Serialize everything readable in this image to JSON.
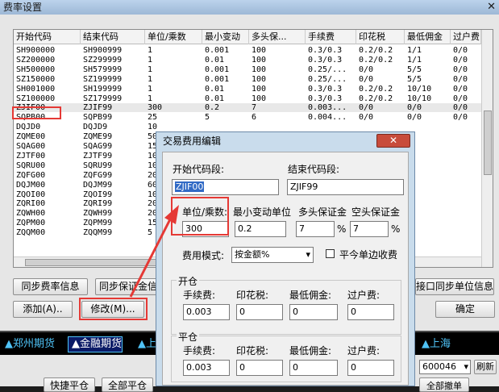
{
  "window": {
    "title": "费率设置",
    "close": "✕"
  },
  "table": {
    "columns": [
      "开始代码",
      "结束代码",
      "单位/乘数",
      "最小变动",
      "多头保...",
      "手续费",
      "印花税",
      "最低佣金",
      "过户费"
    ],
    "rows": [
      [
        "SH900000",
        "SH900999",
        "1",
        "0.001",
        "100",
        "0.3/0.3",
        "0.2/0.2",
        "1/1",
        "0/0"
      ],
      [
        "SZ200000",
        "SZ299999",
        "1",
        "0.01",
        "100",
        "0.3/0.3",
        "0.2/0.2",
        "1/1",
        "0/0"
      ],
      [
        "SH500000",
        "SH579999",
        "1",
        "0.001",
        "100",
        "0.25/...",
        "0/0",
        "5/5",
        "0/0"
      ],
      [
        "SZ150000",
        "SZ199999",
        "1",
        "0.001",
        "100",
        "0.25/...",
        "0/0",
        "5/5",
        "0/0"
      ],
      [
        "SH001000",
        "SH199999",
        "1",
        "0.01",
        "100",
        "0.3/0.3",
        "0.2/0.2",
        "10/10",
        "0/0"
      ],
      [
        "SZ100000",
        "SZ179999",
        "1",
        "0.01",
        "100",
        "0.3/0.3",
        "0.2/0.2",
        "10/10",
        "0/0"
      ],
      [
        "ZJIF00",
        "ZJIF99",
        "300",
        "0.2",
        "7",
        "0.003...",
        "0/0",
        "0/0",
        "0/0"
      ],
      [
        "SQPB00",
        "SQPB99",
        "25",
        "5",
        "6",
        "0.004...",
        "0/0",
        "0/0",
        "0/0"
      ],
      [
        "DQJD0",
        "DQJD9",
        "10",
        "",
        "",
        "",
        "",
        "",
        ""
      ],
      [
        "ZQME00",
        "ZQME99",
        "50",
        "",
        "",
        "",
        "",
        "",
        ""
      ],
      [
        "SQAG00",
        "SQAG99",
        "15",
        "",
        "",
        "",
        "",
        "",
        ""
      ],
      [
        "ZJTF00",
        "ZJTF99",
        "10",
        "",
        "",
        "",
        "",
        "",
        ""
      ],
      [
        "SQRU00",
        "SQRU99",
        "10",
        "",
        "",
        "",
        "",
        "",
        ""
      ],
      [
        "ZQFG00",
        "ZQFG99",
        "20",
        "",
        "",
        "",
        "",
        "",
        ""
      ],
      [
        "DQJM00",
        "DQJM99",
        "60",
        "",
        "",
        "",
        "",
        "",
        ""
      ],
      [
        "ZQOI00",
        "ZQOI99",
        "10",
        "",
        "",
        "",
        "",
        "",
        ""
      ],
      [
        "ZQRI00",
        "ZQRI99",
        "20",
        "",
        "",
        "",
        "",
        "",
        ""
      ],
      [
        "ZQWH00",
        "ZQWH99",
        "20",
        "",
        "",
        "",
        "",
        "",
        ""
      ],
      [
        "ZQPM00",
        "ZQPM99",
        "15",
        "",
        "",
        "",
        "",
        "",
        ""
      ],
      [
        "ZQQM00",
        "ZQQM99",
        "5",
        "",
        "",
        "",
        "",
        "",
        ""
      ]
    ],
    "selected_row": 6,
    "truncated_col": "过户费"
  },
  "buttons": {
    "sync_fee": "同步费率信息",
    "sync_margin": "同步保证金信",
    "sync_unit": "接口同步单位信息",
    "add": "添加(A)..",
    "modify": "修改(M)...",
    "ok": "确定"
  },
  "ticker": [
    {
      "name": "郑州期货",
      "color": "#4fc3f7"
    },
    {
      "name": "金融期货",
      "color": "#ffffff"
    },
    {
      "name": "上",
      "color": "#4fc3f7"
    },
    {
      "name": "上海",
      "color": "#4fc3f7"
    }
  ],
  "bottom": {
    "btn1": "快捷平仓",
    "btn2": "全部平仓",
    "btn3": "全部撤单",
    "code": "600046",
    "refresh": "刷新"
  },
  "dialog": {
    "title": "交易费用编辑",
    "close": "✕",
    "start_code_label": "开始代码段:",
    "end_code_label": "结束代码段:",
    "start_code": "ZJIF00",
    "end_code": "ZJIF99",
    "unit_label": "单位/乘数:",
    "min_change_label": "最小变动单位",
    "long_margin_label": "多头保证金",
    "short_margin_label": "空头保证金",
    "unit": "300",
    "min_change": "0.2",
    "long_margin": "7",
    "short_margin": "7",
    "percent": "%",
    "fee_mode_label": "费用模式:",
    "fee_mode": "按金额%",
    "single_side_label": "平今单边收费",
    "open": {
      "title": "开仓",
      "fee_label": "手续费:",
      "stamp_label": "印花税:",
      "min_comm_label": "最低佣金:",
      "transfer_label": "过户费:",
      "fee": "0.003",
      "stamp": "0",
      "min_comm": "0",
      "transfer": "0"
    },
    "close_pos": {
      "title": "平仓",
      "fee_label": "手续费:",
      "stamp_label": "印花税:",
      "min_comm_label": "最低佣金:",
      "transfer_label": "过户费:",
      "fee": "0.003",
      "stamp": "0",
      "min_comm": "0",
      "transfer": "0"
    }
  },
  "colors": {
    "highlight": "#e53935",
    "selection": "#316ac5"
  }
}
